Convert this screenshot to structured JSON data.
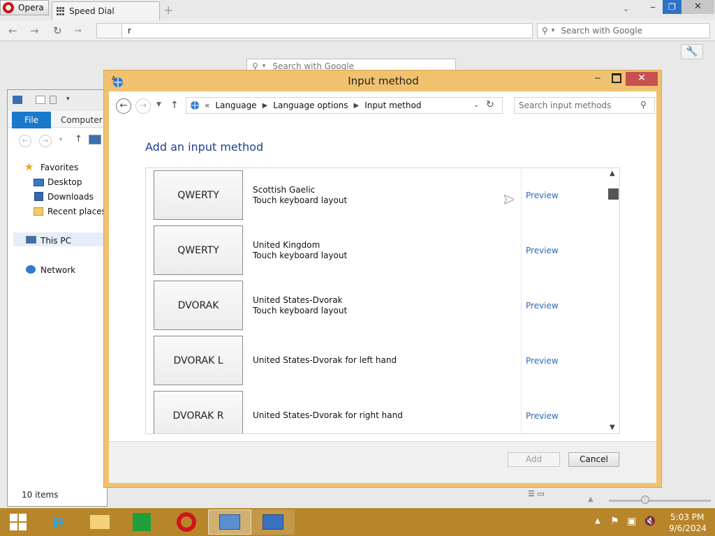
{
  "browser": {
    "menu_label": "Opera",
    "tab_label": "Speed Dial",
    "new_tab_symbol": "+",
    "address_value": "r",
    "search_placeholder": "Search with Google",
    "speeddial_search_placeholder": "Search with Google",
    "window_controls": {
      "minimize": "‒",
      "maximize": "❐",
      "close": "✕"
    }
  },
  "explorer": {
    "ribbon_tabs": [
      "File",
      "Computer"
    ],
    "nav": {
      "favorites": "Favorites",
      "favorites_items": [
        "Desktop",
        "Downloads",
        "Recent places"
      ],
      "this_pc": "This PC",
      "network": "Network"
    },
    "status_count": "10 items"
  },
  "dialog": {
    "title": "Input method",
    "breadcrumb_prefix": "«",
    "breadcrumb": [
      "Language",
      "Language options",
      "Input method"
    ],
    "search_placeholder": "Search input methods",
    "heading": "Add an input method",
    "items": [
      {
        "tile": "QWERTY",
        "line1": "Scottish Gaelic",
        "line2": "Touch keyboard layout",
        "action": "Preview"
      },
      {
        "tile": "QWERTY",
        "line1": "United Kingdom",
        "line2": "Touch keyboard layout",
        "action": "Preview"
      },
      {
        "tile": "DVORAK",
        "line1": "United States-Dvorak",
        "line2": "Touch keyboard layout",
        "action": "Preview"
      },
      {
        "tile": "DVORAK L",
        "line1": "United States-Dvorak for left hand",
        "line2": "",
        "action": "Preview"
      },
      {
        "tile": "DVORAK R",
        "line1": "United States-Dvorak for right hand",
        "line2": "",
        "action": "Preview"
      }
    ],
    "buttons": {
      "add": "Add",
      "cancel": "Cancel"
    }
  },
  "taskbar": {
    "apps": [
      "internet-explorer",
      "file-explorer",
      "store",
      "opera",
      "control-panel",
      "remote-desktop"
    ],
    "accent": "#b8862a",
    "time": "5:03 PM",
    "date": "9/6/2024"
  },
  "colors": {
    "dialog_frame": "#f0c270",
    "close_button": "#c75050",
    "heading_blue": "#1e3f8e",
    "link_blue": "#2b6bb8",
    "file_tab_blue": "#1979ca"
  }
}
